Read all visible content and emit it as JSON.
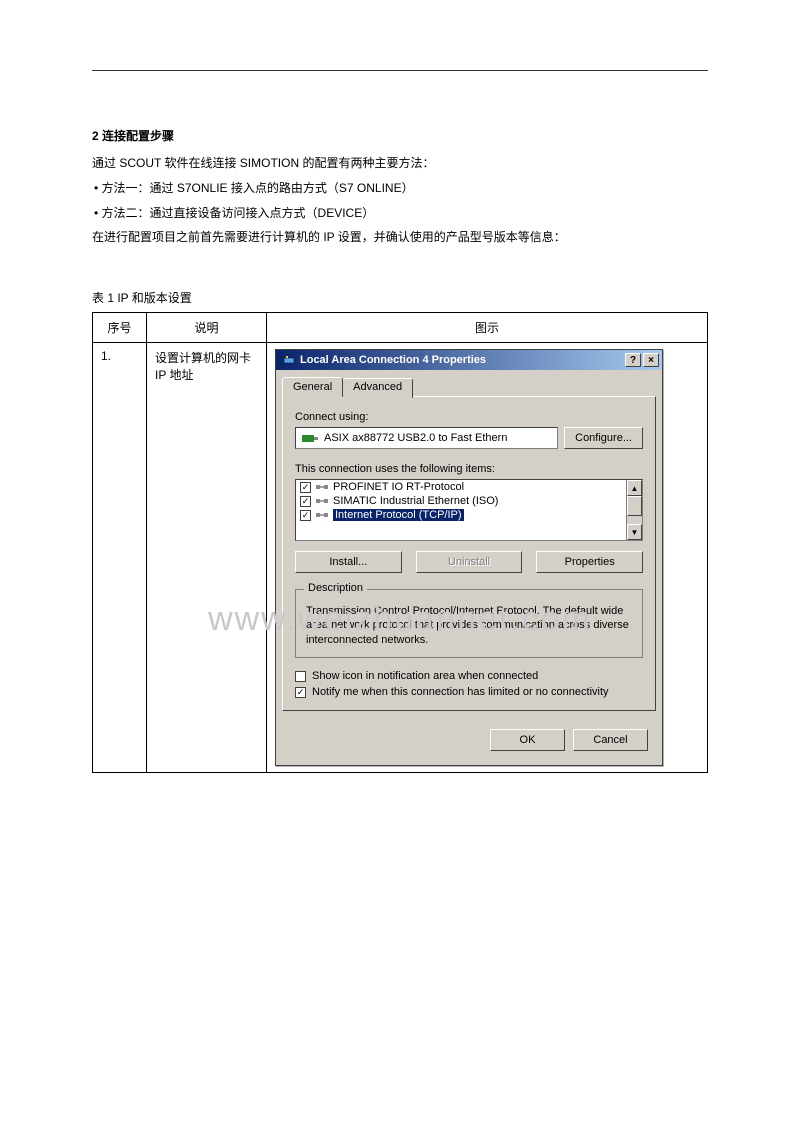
{
  "section": {
    "heading": "2 连接配置步骤",
    "line1": "通过 SCOUT 软件在线连接 SIMOTION 的配置有两种主要方法：",
    "bullet1": "• 方法一：通过 S7ONLIE 接入点的路由方式（S7 ONLINE）",
    "bullet2": "• 方法二：通过直接设备访问接入点方式（DEVICE）",
    "line2": "在进行配置项目之前首先需要进行计算机的 IP 设置，并确认使用的产品型号版本等信息："
  },
  "table": {
    "caption": "表 1 IP 和版本设置",
    "headers": {
      "num": "序号",
      "desc": "说明",
      "img": "图示"
    },
    "row1": {
      "num": "1.",
      "desc": "设置计算机的网卡 IP 地址"
    }
  },
  "dialog": {
    "title": "Local Area Connection 4 Properties",
    "help_btn": "?",
    "close_btn": "×",
    "tabs": {
      "general": "General",
      "advanced": "Advanced"
    },
    "connect_using_label": "Connect using:",
    "adapter": "ASIX ax88772 USB2.0 to Fast Ethern",
    "configure_btn": "Configure...",
    "items_label": "This connection uses the following items:",
    "items": {
      "i1": "PROFINET IO RT-Protocol",
      "i2": "SIMATIC Industrial Ethernet (ISO)",
      "i3": "Internet Protocol (TCP/IP)"
    },
    "install_btn": "Install...",
    "uninstall_btn": "Uninstall",
    "properties_btn": "Properties",
    "description_label": "Description",
    "description_text": "Transmission Control Protocol/Internet Protocol. The default wide area network protocol that provides communication across diverse interconnected networks.",
    "show_icon": "Show icon in notification area when connected",
    "notify_limited": "Notify me when this connection has limited or no connectivity",
    "ok_btn": "OK",
    "cancel_btn": "Cancel"
  },
  "watermark": "www.weizhuannet.com"
}
